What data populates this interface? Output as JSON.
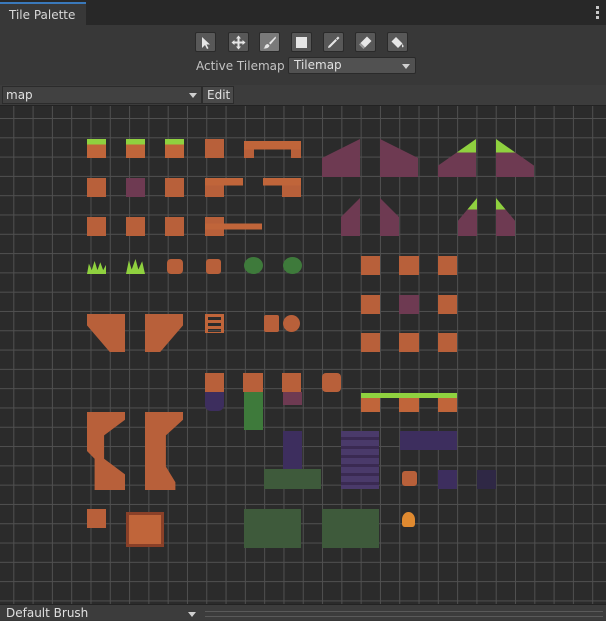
{
  "window": {
    "tab_title": "Tile Palette"
  },
  "toolbar": {
    "tools": [
      {
        "name": "select-tool-icon",
        "active": false
      },
      {
        "name": "move-tool-icon",
        "active": false
      },
      {
        "name": "paint-brush-icon",
        "active": true
      },
      {
        "name": "box-fill-icon",
        "active": false
      },
      {
        "name": "picker-icon",
        "active": false
      },
      {
        "name": "eraser-icon",
        "active": false
      },
      {
        "name": "flood-fill-icon",
        "active": false
      }
    ],
    "active_tilemap_label": "Active Tilemap",
    "active_tilemap_value": "Tilemap"
  },
  "palette": {
    "selected": "map",
    "edit_label": "Edit"
  },
  "brush": {
    "selected": "Default Brush"
  },
  "colors": {
    "accent": "#3a79bb",
    "grass": "#8fd13f",
    "brick": "#c0653a",
    "dirt": "#6e3a52",
    "dungeon": "#3d2e5e",
    "moss": "#3e7a3b"
  }
}
